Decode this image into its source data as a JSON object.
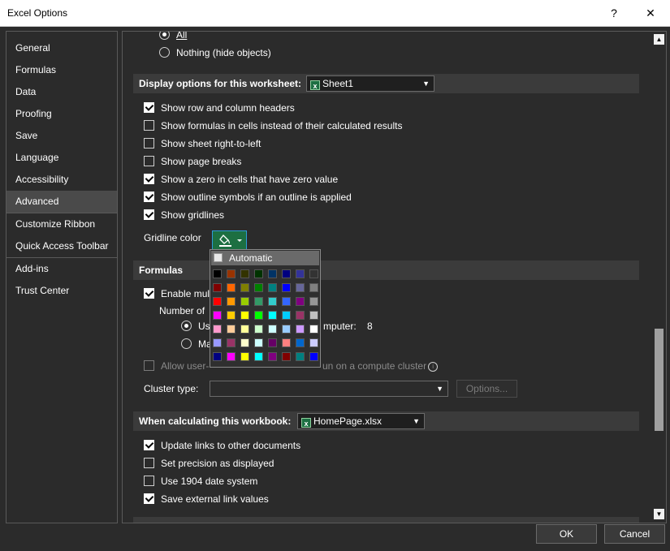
{
  "window": {
    "title": "Excel Options",
    "help_label": "?",
    "close_label": "✕"
  },
  "sidebar": {
    "items": [
      {
        "label": "General"
      },
      {
        "label": "Formulas"
      },
      {
        "label": "Data"
      },
      {
        "label": "Proofing"
      },
      {
        "label": "Save"
      },
      {
        "label": "Language"
      },
      {
        "label": "Accessibility"
      },
      {
        "label": "Advanced",
        "active": true
      },
      {
        "label": "Customize Ribbon"
      },
      {
        "label": "Quick Access Toolbar"
      },
      {
        "label": "Add-ins"
      },
      {
        "label": "Trust Center"
      }
    ]
  },
  "objects": {
    "all_label": "All",
    "nothing_label": "Nothing (hide objects)"
  },
  "worksheet_section": {
    "title": "Display options for this worksheet:",
    "selected_sheet": "Sheet1",
    "options": [
      {
        "label": "Show row and column headers",
        "checked": true
      },
      {
        "label": "Show formulas in cells instead of their calculated results",
        "checked": false
      },
      {
        "label": "Show sheet right-to-left",
        "checked": false
      },
      {
        "label": "Show page breaks",
        "checked": false
      },
      {
        "label": "Show a zero in cells that have zero value",
        "checked": true
      },
      {
        "label": "Show outline symbols if an outline is applied",
        "checked": true
      },
      {
        "label": "Show gridlines",
        "checked": true
      }
    ],
    "gridline_color_label": "Gridline color"
  },
  "formulas_section": {
    "title": "Formulas",
    "enable_multi_label": "Enable mul",
    "number_of_label": "Number of",
    "use_label": "Use",
    "computer_label": "mputer:",
    "processor_count": "8",
    "manual_label": "Ma",
    "allow_label": "Allow user-",
    "compute_cluster_label": "un on a compute cluster",
    "cluster_type_label": "Cluster type:",
    "options_button": "Options..."
  },
  "workbook_section": {
    "title": "When calculating this workbook:",
    "selected_workbook": "HomePage.xlsx",
    "options": [
      {
        "label": "Update links to other documents",
        "checked": true
      },
      {
        "label": "Set precision as displayed",
        "checked": false
      },
      {
        "label": "Use 1904 date system",
        "checked": false
      },
      {
        "label": "Save external link values",
        "checked": true
      }
    ]
  },
  "palette": {
    "automatic_label": "Automatic",
    "colors": [
      [
        "#000000",
        "#993300",
        "#333300",
        "#003300",
        "#003366",
        "#000080",
        "#333399",
        "#333333"
      ],
      [
        "#800000",
        "#ff6600",
        "#808000",
        "#008000",
        "#008080",
        "#0000ff",
        "#666699",
        "#808080"
      ],
      [
        "#ff0000",
        "#ff9900",
        "#99cc00",
        "#339966",
        "#33cccc",
        "#3366ff",
        "#800080",
        "#969696"
      ],
      [
        "#ff00ff",
        "#ffcc00",
        "#ffff00",
        "#00ff00",
        "#00ffff",
        "#00ccff",
        "#993366",
        "#c0c0c0"
      ],
      [
        "#ff99cc",
        "#ffcc99",
        "#ffff99",
        "#ccffcc",
        "#ccffff",
        "#99ccff",
        "#cc99ff",
        "#ffffff"
      ],
      [
        "#9999ff",
        "#993366",
        "#ffffcc",
        "#ccffff",
        "#660066",
        "#ff8080",
        "#0066cc",
        "#ccccff"
      ],
      [
        "#000080",
        "#ff00ff",
        "#ffff00",
        "#00ffff",
        "#800080",
        "#800000",
        "#008080",
        "#0000ff"
      ]
    ]
  },
  "footer": {
    "ok_label": "OK",
    "cancel_label": "Cancel"
  },
  "colors": {
    "accent": "#2e9bd8",
    "excel_green": "#1d6f42"
  }
}
